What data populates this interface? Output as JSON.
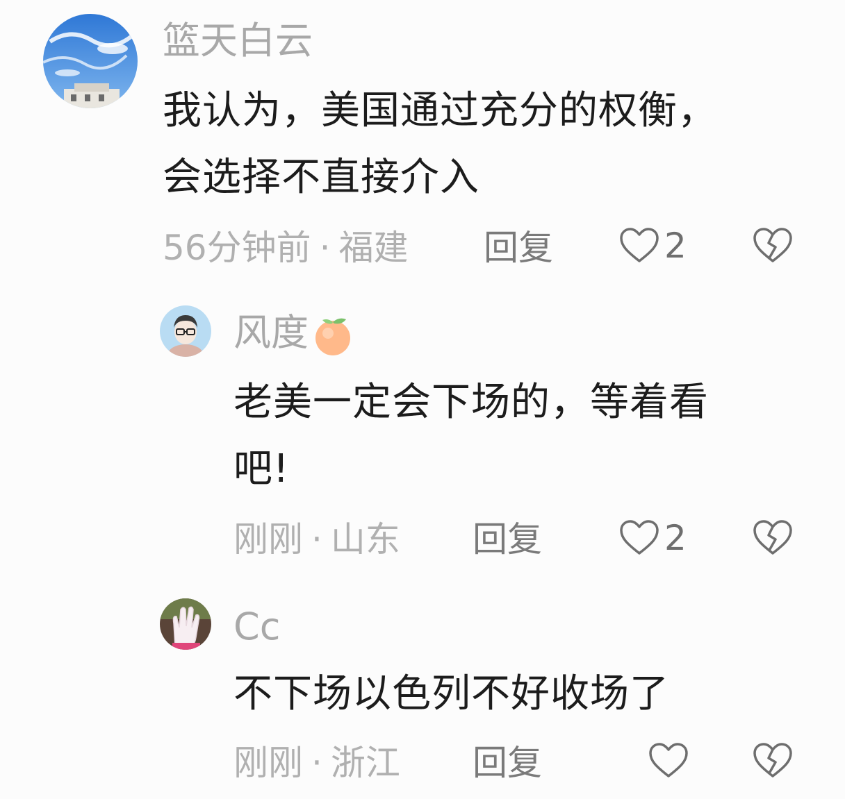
{
  "comments": [
    {
      "username": "篮天白云",
      "text_line1": "我认为，美国通过充分的权衡，",
      "text_line2": "会选择不直接介入",
      "time": "56分钟前",
      "location": "福建",
      "reply_label": "回复",
      "likes": "2"
    },
    {
      "username": "风度",
      "text_line1": "老美一定会下场的，等着看",
      "text_line2": "吧!",
      "time": "刚刚",
      "location": "山东",
      "reply_label": "回复",
      "likes": "2"
    },
    {
      "username": "Cc",
      "text_line1": "不下场以色列不好收场了",
      "time": "刚刚",
      "location": "浙江",
      "reply_label": "回复",
      "likes": ""
    }
  ],
  "separator": "·",
  "colors": {
    "background": "#fcfcfc",
    "username": "#a8a8a8",
    "meta": "#b0b0b0",
    "reply": "#7a7a7a",
    "text": "#1c1c1c",
    "icon": "#6e6e6e"
  },
  "icons": {
    "like": "heart-outline-icon",
    "dislike": "broken-heart-icon",
    "badge": "orange-fruit-emoji"
  }
}
